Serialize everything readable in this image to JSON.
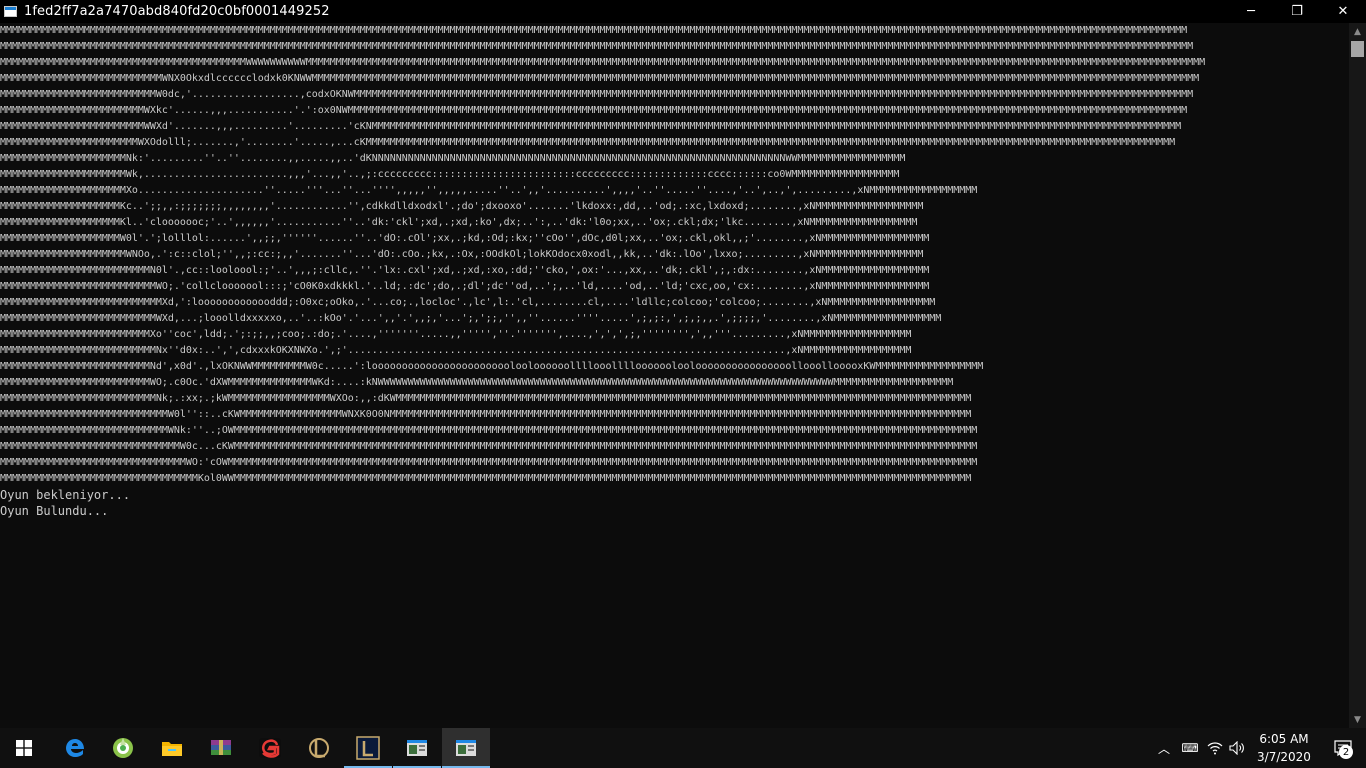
{
  "window": {
    "title": "1fed2ff7a2a7470abd840fd20c0bf0001449252",
    "minimize_glyph": "─",
    "restore_glyph": "❐",
    "close_glyph": "✕"
  },
  "console": {
    "ascii_art": "MMMMMMMMMMMMMMMMMMMMMMMMMMMMMMMMMMMMMMMMMMMMMMMMMMMMMMMMMMMMMMMMMMMMMMMMMMMMMMMMMMMMMMMMMMMMMMMMMMMMMMMMMMMMMMMMMMMMMMMMMMMMMMMMMMMMMMMMMMMMMMMMMMMMMMMMMMMMMMMMMMMMMMMMMMMMMMMMMMMMMMMMMMMMMMMMMMMMMM\nMMMMMMMMMMMMMMMMMMMMMMMMMMMMMMMMMMMMMMMMMMMMMMMMMMMMMMMMMMMMMMMMMMMMMMMMMMMMMMMMMMMMMMMMMMMMMMMMMMMMMMMMMMMMMMMMMMMMMMMMMMMMMMMMMMMMMMMMMMMMMMMMMMMMMMMMMMMMMMMMMMMMMMMMMMMMMMMMMMMMMMMMMMMMMMMMMMMMMMM\nMMMMMMMMMMMMMMMMMMMMMMMMMMMMMMMMMMMMMMMMMWWWWWWWWWWMMMMMMMMMMMMMMMMMMMMMMMMMMMMMMMMMMMMMMMMMMMMMMMMMMMMMMMMMMMMMMMMMMMMMMMMMMMMMMMMMMMMMMMMMMMMMMMMMMMMMMMMMMMMMMMMMMMMMMMMMMMMMMMMMMMMMMMMMMMMMMMMMMMMMM\nMMMMMMMMMMMMMMMMMMMMMMMMMMMWNX0Okxdlcccccclodxk0KNWWMMMMMMMMMMMMMMMMMMMMMMMMMMMMMMMMMMMMMMMMMMMMMMMMMMMMMMMMMMMMMMMMMMMMMMMMMMMMMMMMMMMMMMMMMMMMMMMMMMMMMMMMMMMMMMMMMMMMMMMMMMMMMMMMMMMMMMMMMMMMMMMMMMMM\nMMMMMMMMMMMMMMMMMMMMMMMMMMW0dc,'..................,codxOKNWMMMMMMMMMMMMMMMMMMMMMMMMMMMMMMMMMMMMMMMMMMMMMMMMMMMMMMMMMMMMMMMMMMMMMMMMMMMMMMMMMMMMMMMMMMMMMMMMMMMMMMMMMMMMMMMMMMMMMMMMMMMMMMMMMMMMMMMMMMMM\nMMMMMMMMMMMMMMMMMMMMMMMMWXkc'......,,,...........'.':ox0NWMMMMMMMMMMMMMMMMMMMMMMMMMMMMMMMMMMMMMMMMMMMMMMMMMMMMMMMMMMMMMMMMMMMMMMMMMMMMMMMMMMMMMMMMMMMMMMMMMMMMMMMMMMMMMMMMMMMMMMMMMMMMMMMMMMMMMMMMMMMM\nMMMMMMMMMMMMMMMMMMMMMMMMWWXd'.......,,,.........'.........'cKNMMMMMMMMMMMMMMMMMMMMMMMMMMMMMMMMMMMMMMMMMMMMMMMMMMMMMMMMMMMMMMMMMMMMMMMMMMMMMMMMMMMMMMMMMMMMMMMMMMMMMMMMMMMMMMMMMMMMMMMMMMMMMMMMMMMMMMM\nMMMMMMMMMMMMMMMMMMMMMMMWXOdolll;.......,'........'.....,...cKMMMMMMMMMMMMMMMMMMMMMMMMMMMMMMMMMMMMMMMMMMMMMMMMMMMMMMMMMMMMMMMMMMMMMMMMMMMMMMMMMMMMMMMMMMMMMMMMMMMMMMMMMMMMMMMMMMMMMMMMMMMMMMMMMMMMMMM\nMMMMMMMMMMMMMMMMMMMMMNk:'.........''..''........,,.....,,..'dKNNNNNNNNNNNNNNNNNNNNNNNNNNNNNNNNNNNNNNNNNNNNNNNNNNNNNNNNNNNNNNNNNNNNNWWMMMMMMMMMMMMMMMMMM\nMMMMMMMMMMMMMMMMMMMMMWk,........................,,,'...,,'..,;:ccccccccc::::::::::::::::::::::::ccccccccc:::::::::::::cccc::::::co0WMMMMMMMMMMMMMMMMMM\nMMMMMMMMMMMMMMMMMMMMMXo.....................''.....'''...''...'''',,,,,'',,,,,.....''..',,'..........',,,,'..''.....''....,'..',..,',.........,xNMMMMMMMMMMMMMMMMMM\nMMMMMMMMMMMMMMMMMMMMKc..';;,,:;;;;;;;,,,,,,,,'............'',cdkkdlldxodxl'.;do';dxooxo'.......'lkdoxx:,dd,..'od;.:xc,lxdoxd;........,xNMMMMMMMMMMMMMMMMMM\nMMMMMMMMMMMMMMMMMMMMKl..'clooooooc;'..',,,,,,'...........''..'dk:'ckl';xd,.;xd,:ko',dx;..':,..'dk:'l0o;xx,..'ox;.ckl;dx;'lkc........,xNMMMMMMMMMMMMMMMMMM\nMMMMMMMMMMMMMMMMMMMMW0l'.';lolllol:......',,;;,''''''......''..'dO:.cOl';xx,.;kd,:Od;:kx;''cOo'',dOc,d0l;xx,..'ox;.ckl,okl,,;'........,xNMMMMMMMMMMMMMMMMMM\nMMMMMMMMMMMMMMMMMMMMMWNOo,.':c::clol;'',,;:cc:;,,'.......''...'dO:.cOo.;kx,.:Ox,:OOdkOl;lokKOdocx0xodl,,kk,..'dk:.lOo',lxxo;.........,xNMMMMMMMMMMMMMMMMMM\nMMMMMMMMMMMMMMMMMMMMMMMMMN0l'.,cc::looloool:;'..',,,;:cllc,.''.'lx:.cxl';xd,.;xd,:xo,:dd;''cko,',ox:'...,xx,..'dk;.ckl',;,:dx:........,xNMMMMMMMMMMMMMMMMMM\nMMMMMMMMMMMMMMMMMMMMMMMMMMWO;.'collclooooool:::;'cO0K0xdkkkl.'..ld;.:dc';do,.;dl';dc''od,..';,..'ld,....'od,..'ld;'cxc,oo,'cx:........,xNMMMMMMMMMMMMMMMMMM\nMMMMMMMMMMMMMMMMMMMMMMMMMMMXd,':looooooooooooddd;:O0xc;oOko,.'...co;.,locloc'.,lc',l:.'cl,........cl,....'ldllc;colcoo;'colcoo;........,xNMMMMMMMMMMMMMMMMMM\nMMMMMMMMMMMMMMMMMMMMMMMMMMWXd,...;looolldxxxxxo,..'..:kOo'.'...',,'.',,;,'...';,';;,'',,''......''''.....',;,;:,',;,;,,.',;;;;,'........,xNMMMMMMMMMMMMMMMMMM\nMMMMMMMMMMMMMMMMMMMMMMMMMXo''coc',ldd;.';:;;,,;coo;.:do;.'....,'''''''.....,,''''',''.''''''',....,',',',;,'''''''',',,'''.........,xNMMMMMMMMMMMMMMMMMM\nMMMMMMMMMMMMMMMMMMMMMMMMMMNx''d0x:..',',cdxxxkOKXNWXo.',;'.........................................................................,xNMMMMMMMMMMMMMMMMMM\nMMMMMMMMMMMMMMMMMMMMMMMMMNd',x0d'.,lxOKNWWMMMMMMMMMW0c.....':looooooooooooooooooooooolooloooooollllooolllloooooolooloooooooooooooooollooollooooxKWMMMMMMMMMMMMMMMMMM\nMMMMMMMMMMMMMMMMMMMMMMMMMWO;.c0Oc.'dXWMMMMMMMMMMMMMMWKd:....:kNWWWWWWWWWWWWWWWWWWWWWWWWWWWWWWWWWWWWWWWWWWWWWWWWWWWWWWWWWWWWWWWWWWWWWWWWWWWWMMMMMMMMMMMMMMMMMMMM\nMMMMMMMMMMMMMMMMMMMMMMMMMMNk;.:xx;.;kWMMMMMMMMMMMMMMMMMWXOo:,,:dKWMMMMMMMMMMMMMMMMMMMMMMMMMMMMMMMMMMMMMMMMMMMMMMMMMMMMMMMMMMMMMMMMMMMMMMMMMMMMMMMMMMMMMMMMMMMMMMMM\nMMMMMMMMMMMMMMMMMMMMMMMMMMMMW0l''::..cKWMMMMMMMMMMMMMMMMMWNXK0O0NMMMMMMMMMMMMMMMMMMMMMMMMMMMMMMMMMMMMMMMMMMMMMMMMMMMMMMMMMMMMMMMMMMMMMMMMMMMMMMMMMMMMMMMMMMMMMMMMM\nMMMMMMMMMMMMMMMMMMMMMMMMMMMMWNk:''..;OWMMMMMMMMMMMMMMMMMMMMMMMMMMMMMMMMMMMMMMMMMMMMMMMMMMMMMMMMMMMMMMMMMMMMMMMMMMMMMMMMMMMMMMMMMMMMMMMMMMMMMMMMMMMMMMMMMMMMMMMMMMMM\nMMMMMMMMMMMMMMMMMMMMMMMMMMMMMMW0c...cKWMMMMMMMMMMMMMMMMMMMMMMMMMMMMMMMMMMMMMMMMMMMMMMMMMMMMMMMMMMMMMMMMMMMMMMMMMMMMMMMMMMMMMMMMMMMMMMMMMMMMMMMMMMMMMMMMMMMMMMMMMMMM\nMMMMMMMMMMMMMMMMMMMMMMMMMMMMMMMWO:'cOWMMMMMMMMMMMMMMMMMMMMMMMMMMMMMMMMMMMMMMMMMMMMMMMMMMMMMMMMMMMMMMMMMMMMMMMMMMMMMMMMMMMMMMMMMMMMMMMMMMMMMMMMMMMMMMMMMMMMMMMMMMMMM\nMMMMMMMMMMMMMMMMMMMMMMMMMMMMMMMMMKol0WWMMMMMMMMMMMMMMMMMMMMMMMMMMMMMMMMMMMMMMMMMMMMMMMMMMMMMMMMMMMMMMMMMMMMMMMMMMMMMMMMMMMMMMMMMMMMMMMMMMMMMMMMMMMMMMMMMMMMMMMMMMM",
    "status_lines": [
      "Oyun bekleniyor...",
      "Oyun Bulundu..."
    ]
  },
  "taskbar": {
    "items": [
      {
        "name": "start-button",
        "icon": "windows-logo-icon"
      },
      {
        "name": "edge",
        "icon": "edge-icon"
      },
      {
        "name": "app-green",
        "icon": "green-disc-icon"
      },
      {
        "name": "file-explorer",
        "icon": "folder-icon"
      },
      {
        "name": "winrar",
        "icon": "winrar-icon"
      },
      {
        "name": "garena",
        "icon": "garena-icon"
      },
      {
        "name": "league-client",
        "icon": "league-icon"
      },
      {
        "name": "league-launcher",
        "icon": "league-launcher-icon"
      },
      {
        "name": "console-window-1",
        "icon": "console-icon"
      },
      {
        "name": "console-window-2",
        "icon": "console-icon"
      }
    ],
    "tray": {
      "chevron_glyph": "︿",
      "ime_glyph": "⌨",
      "wifi_glyph": "◠",
      "volume_glyph": "🔈"
    },
    "clock": {
      "time": "6:05 AM",
      "date": "3/7/2020"
    },
    "notifications": {
      "count": "2"
    }
  },
  "colors": {
    "console_bg": "#0c0c0c",
    "console_fg": "#cccccc",
    "taskbar_bg": "#101010",
    "active_underline": "#76b9ed"
  }
}
